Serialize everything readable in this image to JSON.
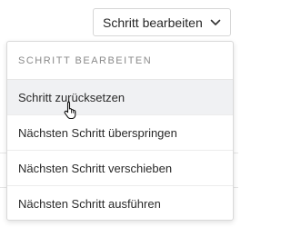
{
  "trigger": {
    "label": "Schritt bearbeiten",
    "icon": "chevron-down-icon"
  },
  "menu": {
    "header": "SCHRITT BEARBEITEN",
    "items": [
      {
        "label": "Schritt zurücksetzen",
        "state": "hover"
      },
      {
        "label": "Nächsten Schritt überspringen"
      },
      {
        "label": "Nächsten Schritt verschieben"
      },
      {
        "label": "Nächsten Schritt ausführen"
      }
    ]
  },
  "cursor": {
    "icon": "hand-pointer-icon"
  },
  "colors": {
    "border": "#d9d9d9",
    "hover_bg": "#f0f1f3",
    "header_text": "#8a8a8a",
    "text": "#2a2a2a"
  }
}
